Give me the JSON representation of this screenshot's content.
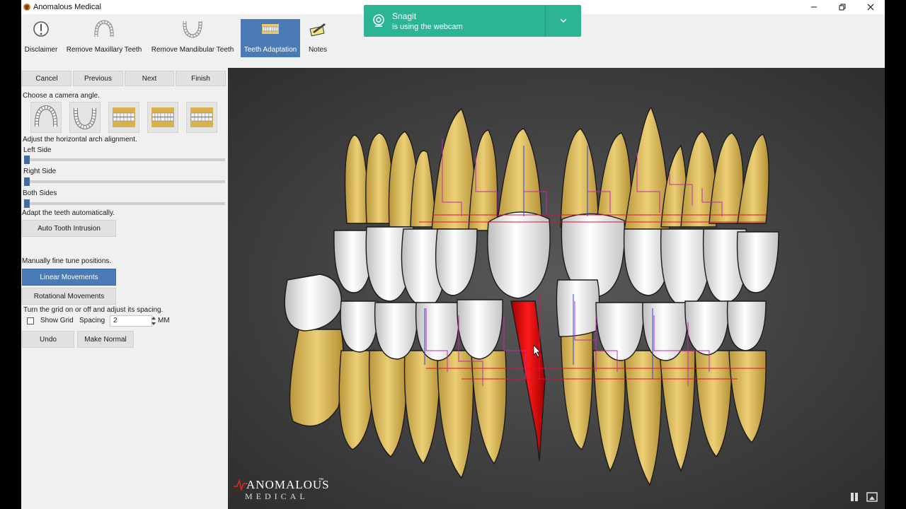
{
  "window": {
    "title": "Anomalous Medical"
  },
  "toolbar": {
    "items": [
      {
        "label": "Disclaimer"
      },
      {
        "label": "Remove Maxillary Teeth"
      },
      {
        "label": "Remove Mandibular Teeth"
      },
      {
        "label": "Teeth Adaptation",
        "active": true
      },
      {
        "label": "Notes"
      }
    ]
  },
  "panel": {
    "nav": {
      "cancel": "Cancel",
      "previous": "Previous",
      "next": "Next",
      "finish": "Finish"
    },
    "camera_prompt": "Choose a camera angle.",
    "arch_prompt": "Adjust the horizontal arch alignment.",
    "sliders": {
      "left": {
        "label": "Left Side",
        "value": 0
      },
      "right": {
        "label": "Right Side",
        "value": 0
      },
      "both": {
        "label": "Both Sides",
        "value": 0
      }
    },
    "auto_prompt": "Adapt the teeth automatically.",
    "auto_intrusion": "Auto Tooth Intrusion",
    "manual_prompt": "Manually fine tune positions.",
    "linear": "Linear Movements",
    "rotational": "Rotational Movements",
    "grid_prompt": "Turn the grid on or off and adjust its spacing.",
    "show_grid": "Show Grid",
    "show_grid_checked": false,
    "spacing_label": "Spacing",
    "spacing_value": "2",
    "spacing_unit": "MM",
    "undo": "Undo",
    "make_normal": "Make Normal"
  },
  "viewport": {
    "brand": "ANOMALOUS",
    "brand_sub": "MEDICAL",
    "trademark": "™",
    "colors": {
      "tooth_crown": "#f4f4f4",
      "tooth_root": "#e8c970",
      "selected": "#e00000",
      "grid_red": "#e0103a",
      "grid_blue": "#3340e0",
      "grid_magenta": "#c02ab0"
    }
  },
  "notification": {
    "app": "Snagit",
    "message": "is using the webcam",
    "color": "#2bb595"
  },
  "accent": "#4a7bb4"
}
